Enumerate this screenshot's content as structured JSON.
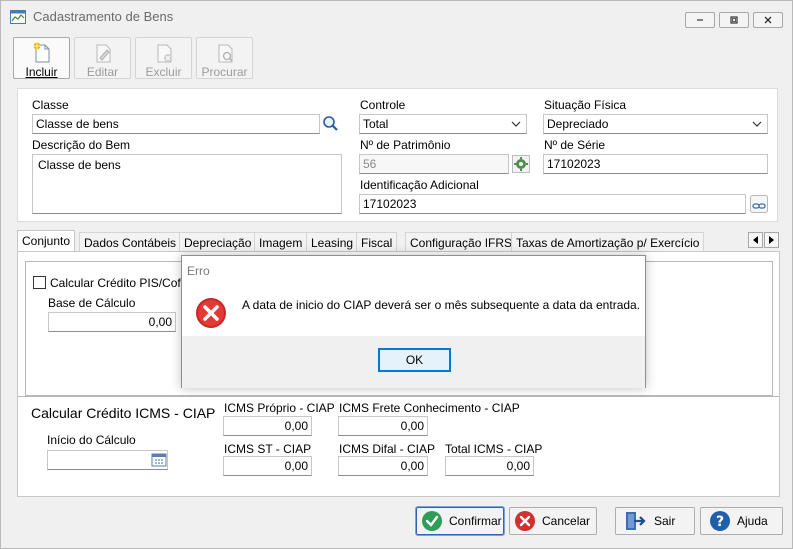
{
  "window": {
    "title": "Cadastramento de Bens"
  },
  "toolbar": {
    "incluir": "Incluir",
    "editar": "Editar",
    "excluir": "Excluir",
    "procurar": "Procurar"
  },
  "form": {
    "classe_label": "Classe",
    "classe_value": "Classe de bens",
    "descricao_label": "Descrição do Bem",
    "descricao_value": "Classe de bens",
    "controle_label": "Controle",
    "controle_value": "Total",
    "situacao_label": "Situação Física",
    "situacao_value": "Depreciado",
    "patrimonio_label": "Nº de Patrimônio",
    "patrimonio_value": "56",
    "serie_label": "Nº de Série",
    "serie_value": "17102023",
    "identificacao_label": "Identificação Adicional",
    "identificacao_value": "17102023"
  },
  "tabs": [
    "Conjunto",
    "Dados Contábeis",
    "Depreciação",
    "Imagem",
    "Leasing",
    "Fiscal",
    "Configuração IFRS",
    "Taxas de Amortização p/ Exercício"
  ],
  "fiscal": {
    "pis_checkbox_label": "Calcular Crédito PIS/Cofins",
    "base_calculo_label": "Base de Cálculo",
    "base_calculo_value": "0,00",
    "icms_title": "Calcular Crédito ICMS - CIAP",
    "inicio_label": "Início do Cálculo",
    "inicio_value": "",
    "icms_proprio_label": "ICMS Próprio - CIAP",
    "icms_proprio_value": "0,00",
    "icms_frete_label": "ICMS Frete Conhecimento - CIAP",
    "icms_frete_value": "0,00",
    "icms_st_label": "ICMS ST - CIAP",
    "icms_st_value": "0,00",
    "icms_difal_label": "ICMS Difal - CIAP",
    "icms_difal_value": "0,00",
    "total_icms_label": "Total ICMS - CIAP",
    "total_icms_value": "0,00"
  },
  "dialog": {
    "title": "Erro",
    "message": "A data de inicio do CIAP deverá ser o mês subsequente a data da entrada.",
    "ok_label": "OK"
  },
  "buttons": {
    "confirmar": "Confirmar",
    "cancelar": "Cancelar",
    "sair": "Sair",
    "ajuda": "Ajuda"
  },
  "colors": {
    "accent": "#0078d7",
    "error": "#d32f2f",
    "confirm": "#2e9d57"
  }
}
